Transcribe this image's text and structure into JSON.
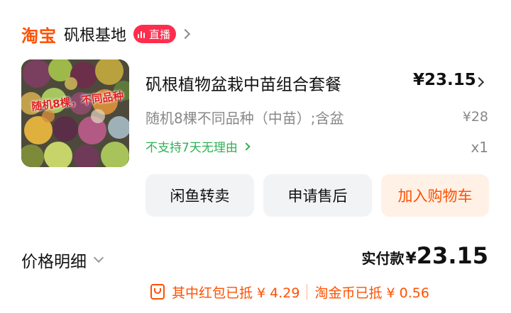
{
  "store": {
    "logo": "淘宝",
    "name": "矾根基地",
    "live_label": "直播"
  },
  "product": {
    "image_caption": "随机8棵，不同品种",
    "title": "矾根植物盆栽中苗组合套餐",
    "price": "¥23.15",
    "sku": "随机8棵不同品种（中苗）;含盆",
    "original_price": "¥28",
    "policy": "不支持7天无理由",
    "quantity": "x1"
  },
  "actions": {
    "resell_label": "闲鱼转卖",
    "aftersale_label": "申请售后",
    "cart_label": "加入购物车"
  },
  "summary": {
    "price_detail_label": "价格明细",
    "paid_label": "实付款",
    "paid_symbol": "¥",
    "paid_value": "23.15",
    "red_packet": "其中红包已抵 ¥ 4.29",
    "coin": "淘金币已抵 ¥ 0.56"
  },
  "colors": {
    "brand": "#ff5000",
    "live_badge": "#ff2d4d",
    "policy_green": "#2fb153",
    "button_grey": "#f2f3f5",
    "cart_bg": "#fff1e6"
  },
  "icons": [
    "live-bars-icon",
    "chevron-right-icon",
    "chevron-down-icon",
    "coupon-icon"
  ]
}
